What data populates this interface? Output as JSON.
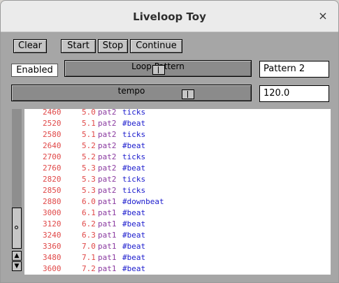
{
  "window": {
    "title": "Liveloop Toy",
    "close_glyph": "×"
  },
  "toolbar": {
    "clear": "Clear",
    "start": "Start",
    "stop": "Stop",
    "continue": "Continue"
  },
  "loop_control": {
    "enabled_label": "Enabled",
    "scale_label": "Loop Pattern",
    "pattern_value": "Pattern 2"
  },
  "tempo_control": {
    "scale_label": "tempo",
    "value": "120.0"
  },
  "log": {
    "rows": [
      {
        "time": "2460",
        "beat": "5.0",
        "pattern": "pat2",
        "event": "ticks"
      },
      {
        "time": "2520",
        "beat": "5.1",
        "pattern": "pat2",
        "event": "#beat"
      },
      {
        "time": "2580",
        "beat": "5.1",
        "pattern": "pat2",
        "event": "ticks"
      },
      {
        "time": "2640",
        "beat": "5.2",
        "pattern": "pat2",
        "event": "#beat"
      },
      {
        "time": "2700",
        "beat": "5.2",
        "pattern": "pat2",
        "event": "ticks"
      },
      {
        "time": "2760",
        "beat": "5.3",
        "pattern": "pat2",
        "event": "#beat"
      },
      {
        "time": "2820",
        "beat": "5.3",
        "pattern": "pat2",
        "event": "ticks"
      },
      {
        "time": "2850",
        "beat": "5.3",
        "pattern": "pat2",
        "event": "ticks"
      },
      {
        "time": "2880",
        "beat": "6.0",
        "pattern": "pat1",
        "event": "#downbeat"
      },
      {
        "time": "3000",
        "beat": "6.1",
        "pattern": "pat1",
        "event": "#beat"
      },
      {
        "time": "3120",
        "beat": "6.2",
        "pattern": "pat1",
        "event": "#beat"
      },
      {
        "time": "3240",
        "beat": "6.3",
        "pattern": "pat1",
        "event": "#beat"
      },
      {
        "time": "3360",
        "beat": "7.0",
        "pattern": "pat1",
        "event": "#beat"
      },
      {
        "time": "3480",
        "beat": "7.1",
        "pattern": "pat1",
        "event": "#beat"
      },
      {
        "time": "3600",
        "beat": "7.2",
        "pattern": "pat1",
        "event": "#beat"
      }
    ]
  },
  "scrollbar": {
    "up_glyph": "▲",
    "down_glyph": "▼"
  },
  "colors": {
    "time": "#e04848",
    "pattern": "#8a3aa0",
    "event": "#1a1acd"
  }
}
